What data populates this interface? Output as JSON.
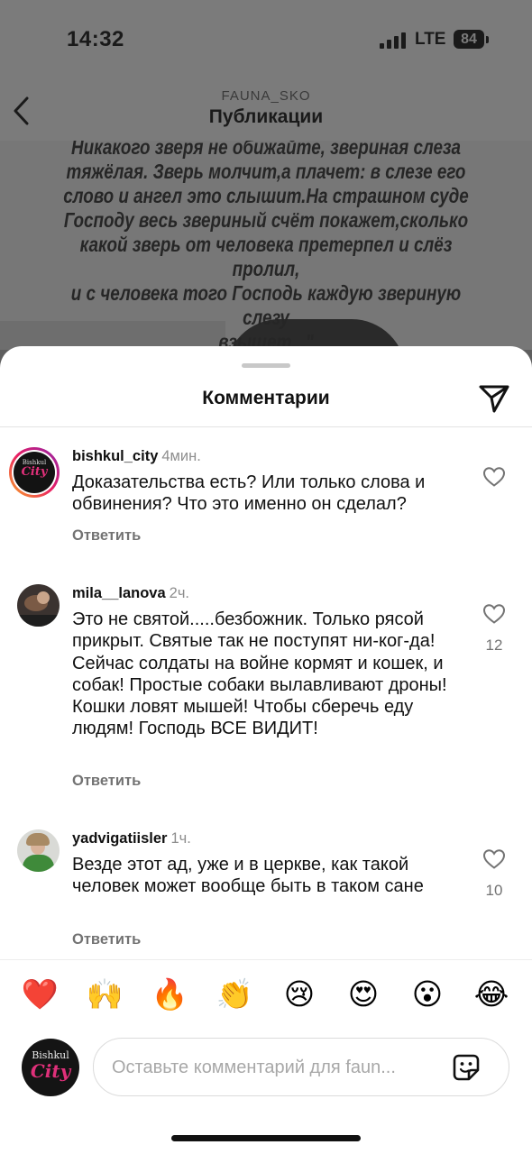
{
  "status": {
    "time": "14:32",
    "network": "LTE",
    "battery": "84"
  },
  "header": {
    "username": "FAUNA_SKO",
    "title": "Публикации"
  },
  "post": {
    "quote": "Никакого зверя не обижайте, звериная слеза\nтяжёлая. Зверь молчит,а плачет: в слезе его\nслово и ангел это слышит.На страшном суде\nГосподу весь звериный счёт покажет,сколько\nкакой зверь от человека претерпел и слёз пролил,\nи с человека того Господь каждую звериную слезу\nвзыщет...\"\nАрхиепископ Амвросий"
  },
  "sheet": {
    "title": "Комментарии"
  },
  "comments": [
    {
      "username": "bishkul_city",
      "time": "4мин.",
      "text": "Доказательства есть? Или только слова и обвинения? Что это именно он сделал?",
      "reply": "Ответить",
      "likes": ""
    },
    {
      "username": "mila__lanova",
      "time": "2ч.",
      "text": "Это не святой.....безбожник. Только рясой прикрыт. Святые так не поступят ни-ког-да! Сейчас солдаты на войне кормят и кошек, и собак! Простые собаки вылавливают дроны! Кошки ловят мышей! Чтобы сберечь еду людям! Господь ВСЕ ВИДИТ!",
      "reply": "Ответить",
      "likes": "12"
    },
    {
      "username": "yadvigatiisler",
      "time": "1ч.",
      "text": "Везде этот ад, уже и в церкве, как такой человек может вообще быть в таком сане",
      "reply": "Ответить",
      "likes": "10"
    }
  ],
  "emojis": [
    "❤️",
    "🙌",
    "🔥",
    "👏",
    "😢",
    "😍",
    "😮",
    "😂"
  ],
  "composer": {
    "placeholder": "Оставьте комментарий для faun..."
  },
  "avatar_logo": {
    "line1": "Bishkul",
    "line2": "City"
  },
  "colors": {
    "accent_pink": "#e0307a",
    "muted": "#737373"
  }
}
